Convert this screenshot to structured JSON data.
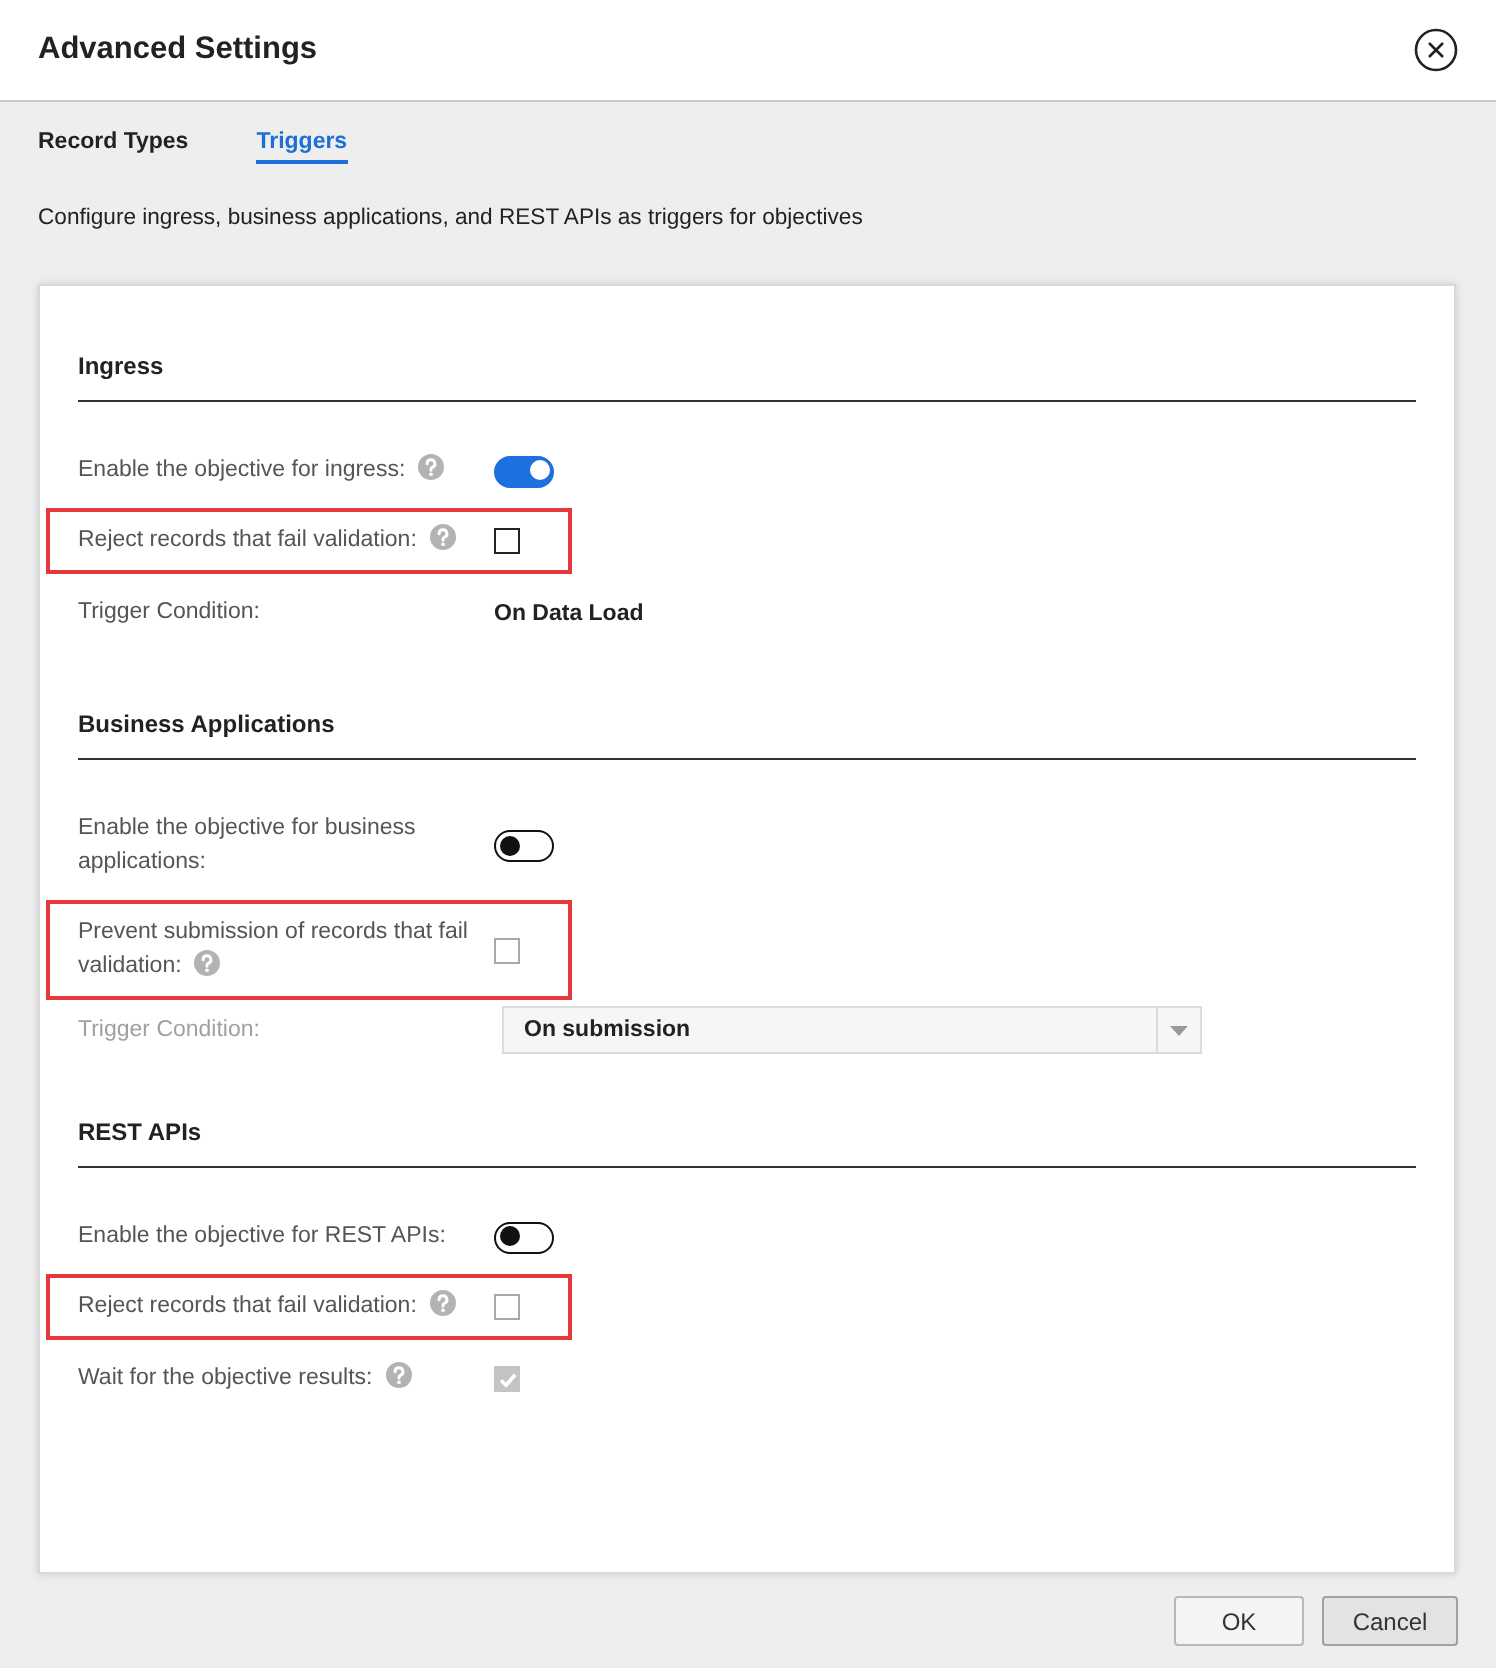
{
  "dialog": {
    "title": "Advanced Settings"
  },
  "tabs": [
    {
      "label": "Record Types",
      "selected": false
    },
    {
      "label": "Triggers",
      "selected": true
    }
  ],
  "description": "Configure ingress, business applications, and REST APIs as triggers for objectives",
  "sections": [
    {
      "heading": "Ingress",
      "rows": [
        {
          "kind": "toggle",
          "label": "Enable the objective for ingress:",
          "help": true,
          "on": true,
          "disabled": false,
          "highlighted": false
        },
        {
          "kind": "checkbox",
          "label": "Reject records that fail validation:",
          "help": true,
          "checked": false,
          "disabled": false,
          "highlighted": true
        },
        {
          "kind": "text",
          "label": "Trigger Condition:",
          "help": false,
          "value": "On Data Load",
          "disabled": false,
          "highlighted": false
        }
      ]
    },
    {
      "heading": "Business Applications",
      "rows": [
        {
          "kind": "toggle",
          "label": "Enable the objective for business applications:",
          "help": false,
          "on": false,
          "disabled": false,
          "highlighted": false
        },
        {
          "kind": "checkbox",
          "label": "Prevent submission of records that fail validation:",
          "help": true,
          "checked": false,
          "disabled": true,
          "highlighted": true
        },
        {
          "kind": "dropdown",
          "label": "Trigger Condition:",
          "help": false,
          "value": "On submission",
          "disabled": true,
          "highlighted": false
        }
      ]
    },
    {
      "heading": "REST APIs",
      "rows": [
        {
          "kind": "toggle",
          "label": "Enable the objective for REST APIs:",
          "help": false,
          "on": false,
          "disabled": false,
          "highlighted": false
        },
        {
          "kind": "checkbox",
          "label": "Reject records that fail validation:",
          "help": true,
          "checked": false,
          "disabled": true,
          "highlighted": true
        },
        {
          "kind": "checkbox",
          "label": "Wait for the objective results:",
          "help": true,
          "checked": true,
          "disabled": true,
          "highlighted": false
        }
      ]
    }
  ],
  "buttons": [
    {
      "label": "OK",
      "focused": false
    },
    {
      "label": "Cancel",
      "focused": true
    }
  ]
}
